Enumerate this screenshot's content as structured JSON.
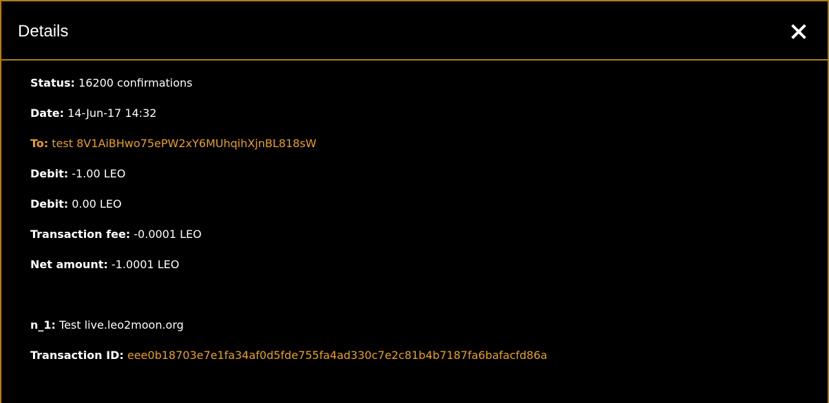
{
  "dialog": {
    "title": "Details",
    "close_glyph": "✕"
  },
  "colors": {
    "background": "#000000",
    "border": "#b07d1e",
    "accent": "#e6a21c",
    "text": "#ffffff"
  },
  "fields": [
    {
      "label": "Status:",
      "value": "16200 confirmations"
    },
    {
      "label": "Date:",
      "value": "14-Jun-17 14:32"
    },
    {
      "label": "To:",
      "value": "test 8V1AiBHwo75ePW2xY6MUhqihXjnBL818sW"
    },
    {
      "label": "Debit:",
      "value": "-1.00 LEO"
    },
    {
      "label": "Debit:",
      "value": "0.00 LEO"
    },
    {
      "label": "Transaction fee:",
      "value": "-0.0001 LEO"
    },
    {
      "label": "Net amount:",
      "value": "-1.0001 LEO"
    },
    {
      "label": "n_1:",
      "value": "Test live.leo2moon.org"
    },
    {
      "label": "Transaction ID:",
      "value": "eee0b18703e7e1fa34af0d5fde755fa4ad330c7e2c81b4b7187fa6bafacfd86a"
    }
  ]
}
